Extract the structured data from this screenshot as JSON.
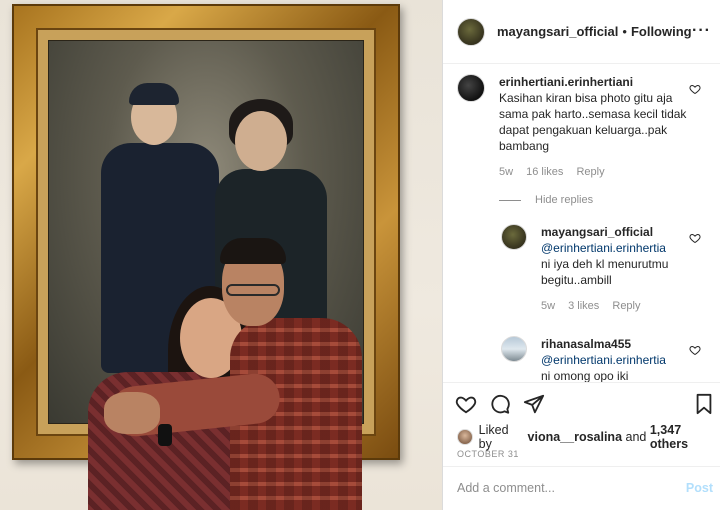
{
  "post": {
    "author": "mayangsari_official",
    "separator": "•",
    "follow_status": "Following",
    "more_icon": "more-horizontal-icon"
  },
  "comments": [
    {
      "user": "erinhertiani.erinhertiani",
      "text": "Kasihan kiran bisa photo gitu aja sama pak harto..semasa kecil tidak dapat pengakuan keluarga..pak bambang",
      "age": "5w",
      "likes": "16 likes",
      "reply": "Reply"
    }
  ],
  "hide_replies": "Hide replies",
  "replies": [
    {
      "user": "mayangsari_official",
      "mention": "@erinhertiani.erinhertia",
      "text": "ni iya deh kl menurutmu begitu..ambill",
      "age": "5w",
      "likes": "3 likes",
      "reply": "Reply"
    },
    {
      "user": "rihanasalma455",
      "mention": "@erinhertiani.erinhertia",
      "text": "ni omong opo iki"
    }
  ],
  "actions": {
    "like_icon": "heart-icon",
    "comment_icon": "comment-icon",
    "share_icon": "send-icon",
    "save_icon": "bookmark-icon"
  },
  "likes": {
    "prefix": "Liked by",
    "user": "viona__rosalina",
    "middle": "and",
    "count": "1,347 others"
  },
  "date": "OCTOBER 31",
  "add_comment": {
    "placeholder": "Add a comment...",
    "post_label": "Post"
  },
  "colors": {
    "link": "#00376b",
    "muted": "#8e8e8e",
    "post_disabled": "#b2dffc"
  }
}
